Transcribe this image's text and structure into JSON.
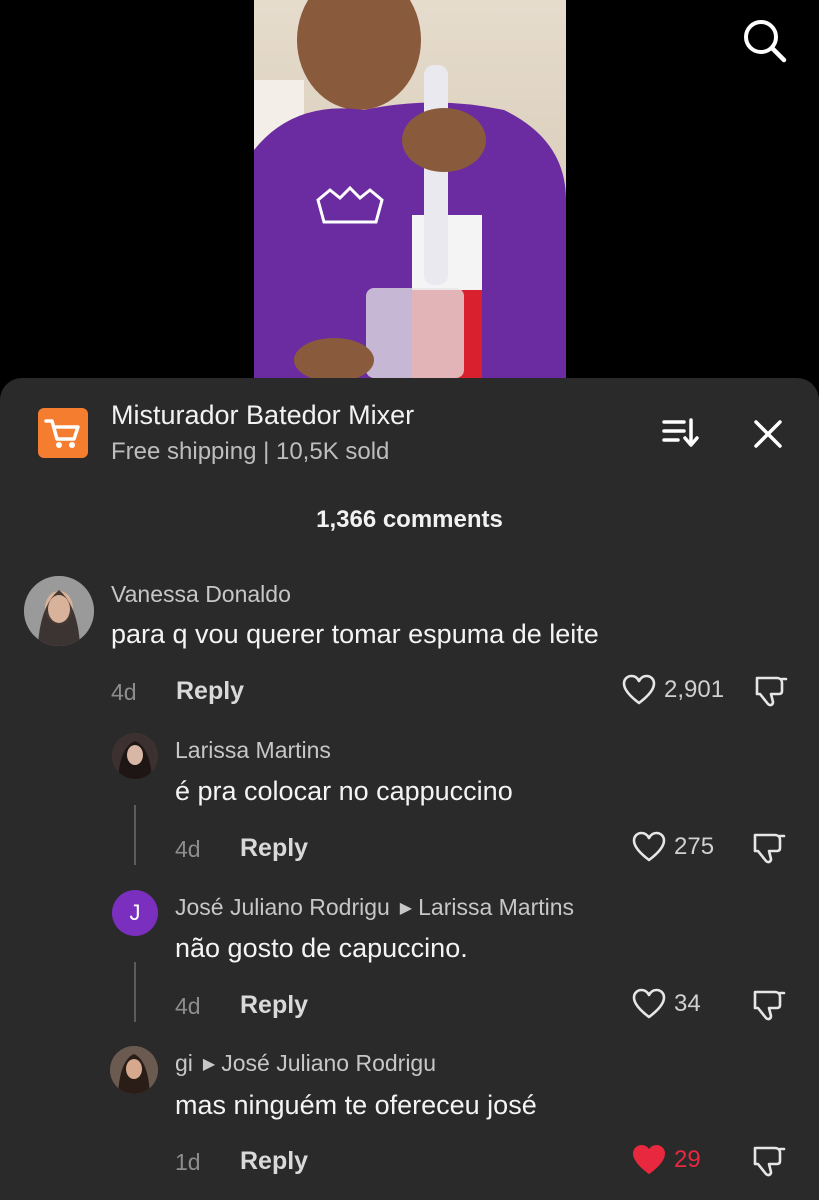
{
  "product": {
    "title": "Misturador Batedor Mixer",
    "subtitle": "Free shipping | 10,5K sold",
    "icon": "shopping-cart-icon",
    "accent": "#f47d30"
  },
  "comments_count": "1,366 comments",
  "comments": [
    {
      "author": "Vanessa Donaldo",
      "reply_to": "",
      "text": "para q vou querer tomar espuma de leite",
      "age": "4d",
      "reply_label": "Reply",
      "likes": "2,901",
      "liked": false
    },
    {
      "author": "Larissa Martins",
      "reply_to": "",
      "text": "é pra colocar no cappuccino",
      "age": "4d",
      "reply_label": "Reply",
      "likes": "275",
      "liked": false
    },
    {
      "author": "José Juliano Rodrigu",
      "reply_to": "Larissa Martins",
      "avatar_letter": "J",
      "avatar_color": "#7b2fbf",
      "text": "não gosto de capuccino.",
      "age": "4d",
      "reply_label": "Reply",
      "likes": "34",
      "liked": false
    },
    {
      "author": "gi",
      "reply_to": "José Juliano Rodrigu",
      "text": "mas ninguém te ofereceu josé",
      "age": "1d",
      "reply_label": "Reply",
      "likes": "29",
      "liked": true,
      "liked_color": "#e8283f"
    }
  ]
}
